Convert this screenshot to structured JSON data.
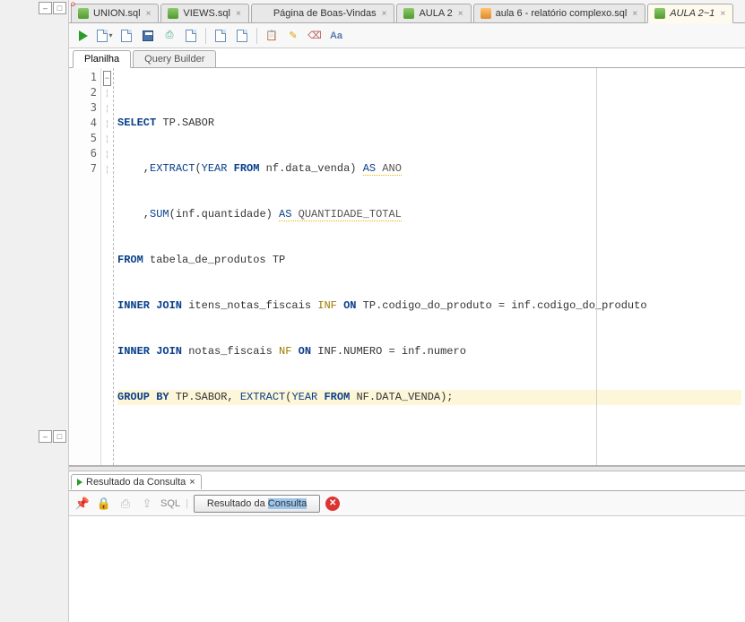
{
  "tabs": [
    {
      "label": "UNION.sql",
      "icon": "sql"
    },
    {
      "label": "VIEWS.sql",
      "icon": "sql"
    },
    {
      "label": "Página de Boas-Vindas",
      "icon": "oracle"
    },
    {
      "label": "AULA 2",
      "icon": "sql"
    },
    {
      "label": "aula 6 - relatório complexo.sql",
      "icon": "sql-mod"
    },
    {
      "label": "AULA 2~1",
      "icon": "sql",
      "active": true
    }
  ],
  "subtabs": {
    "planilha": "Planilha",
    "query_builder": "Query Builder"
  },
  "code": {
    "lines": [
      "SELECT TP.SABOR",
      "    ,EXTRACT(YEAR FROM nf.data_venda) AS ANO",
      "    ,SUM(inf.quantidade) AS QUANTIDADE_TOTAL",
      "FROM tabela_de_produtos TP",
      "INNER JOIN itens_notas_fiscais INF ON TP.codigo_do_produto = inf.codigo_do_produto",
      "INNER JOIN notas_fiscais NF ON INF.NUMERO = inf.numero",
      "GROUP BY TP.SABOR, EXTRACT(YEAR FROM NF.DATA_VENDA);"
    ],
    "line_count": 7,
    "highlighted_line": 7
  },
  "results": {
    "tab_label": "Resultado da Consulta",
    "toolbar_sql": "SQL",
    "button_label_pre": "Resultado da ",
    "button_label_sel": "Consulta"
  },
  "colors": {
    "keyword": "#0a3f8a",
    "alias": "#9a7a00",
    "highlight_line": "#fdf6d9",
    "run_green": "#2a9b2a",
    "error_red": "#d33"
  },
  "toolbar_icons": [
    "run",
    "doc",
    "save",
    "print",
    "undo",
    "doc2",
    "refresh",
    "doc3",
    "paste",
    "export",
    "find",
    "pencil",
    "eraser",
    "text-tool"
  ]
}
